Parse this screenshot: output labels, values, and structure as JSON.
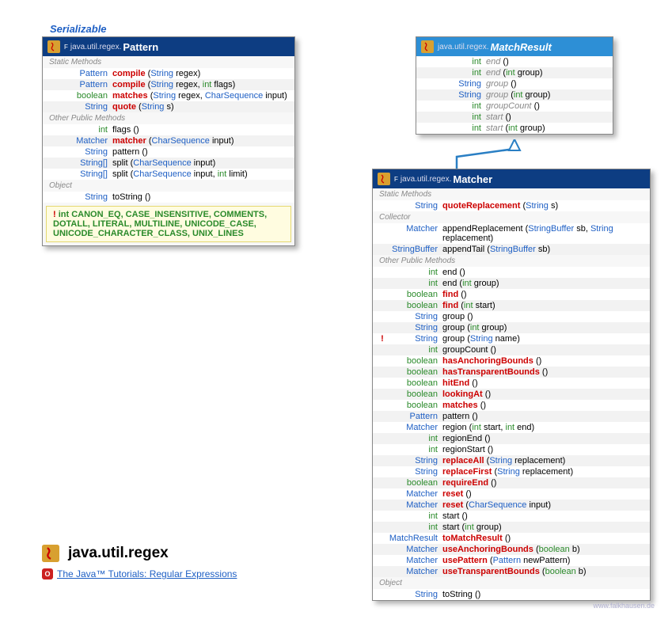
{
  "serializable": "Serializable",
  "pattern": {
    "pkg": "java.util.regex.",
    "name": "Pattern",
    "sections": {
      "static": "Static Methods",
      "other": "Other Public Methods",
      "obj": "Object"
    },
    "staticMethods": [
      {
        "ret": "Pattern",
        "retClass": "t-blue",
        "name": "compile",
        "nameClass": "t-red",
        "sig": "(String regex)"
      },
      {
        "ret": "Pattern",
        "retClass": "t-blue",
        "name": "compile",
        "nameClass": "t-red",
        "sig": "(String regex, int flags)"
      },
      {
        "ret": "boolean",
        "retClass": "t-green",
        "name": "matches",
        "nameClass": "t-red",
        "sig": "(String regex, CharSequence input)"
      },
      {
        "ret": "String",
        "retClass": "t-blue",
        "name": "quote",
        "nameClass": "t-red",
        "sig": "(String s)"
      }
    ],
    "otherMethods": [
      {
        "ret": "int",
        "retClass": "t-green",
        "name": "flags",
        "nameClass": "t-black",
        "sig": "()"
      },
      {
        "ret": "Matcher",
        "retClass": "t-blue",
        "name": "matcher",
        "nameClass": "t-red",
        "sig": "(CharSequence input)"
      },
      {
        "ret": "String",
        "retClass": "t-blue",
        "name": "pattern",
        "nameClass": "t-black",
        "sig": "()"
      },
      {
        "ret": "String[]",
        "retClass": "t-blue",
        "name": "split",
        "nameClass": "t-black",
        "sig": "(CharSequence input)"
      },
      {
        "ret": "String[]",
        "retClass": "t-blue",
        "name": "split",
        "nameClass": "t-black",
        "sig": "(CharSequence input, int limit)"
      }
    ],
    "objMethods": [
      {
        "ret": "String",
        "retClass": "t-blue",
        "name": "toString",
        "nameClass": "t-black",
        "sig": "()"
      }
    ],
    "constants": "int CANON_EQ, CASE_INSENSITIVE, COMMENTS, DOTALL, LITERAL, MULTILINE, UNICODE_CASE, UNICODE_CHARACTER_CLASS, UNIX_LINES"
  },
  "matchresult": {
    "pkg": "java.util.regex.",
    "name": "MatchResult",
    "methods": [
      {
        "ret": "int",
        "retClass": "t-green",
        "name": "end",
        "nameClass": "t-gray-it",
        "sig": "()"
      },
      {
        "ret": "int",
        "retClass": "t-green",
        "name": "end",
        "nameClass": "t-gray-it",
        "sig": "(int group)"
      },
      {
        "ret": "String",
        "retClass": "t-blue",
        "name": "group",
        "nameClass": "t-gray-it",
        "sig": "()"
      },
      {
        "ret": "String",
        "retClass": "t-blue",
        "name": "group",
        "nameClass": "t-gray-it",
        "sig": "(int group)"
      },
      {
        "ret": "int",
        "retClass": "t-green",
        "name": "groupCount",
        "nameClass": "t-gray-it",
        "sig": "()"
      },
      {
        "ret": "int",
        "retClass": "t-green",
        "name": "start",
        "nameClass": "t-gray-it",
        "sig": "()"
      },
      {
        "ret": "int",
        "retClass": "t-green",
        "name": "start",
        "nameClass": "t-gray-it",
        "sig": "(int group)"
      }
    ]
  },
  "matcher": {
    "pkg": "java.util.regex.",
    "name": "Matcher",
    "sections": {
      "static": "Static Methods",
      "collector": "Collector",
      "other": "Other Public Methods",
      "obj": "Object"
    },
    "staticMethods": [
      {
        "ret": "String",
        "retClass": "t-blue",
        "name": "quoteReplacement",
        "nameClass": "t-red",
        "sig": "(String s)"
      }
    ],
    "collectorMethods": [
      {
        "ret": "Matcher",
        "retClass": "t-blue",
        "name": "appendReplacement",
        "nameClass": "t-black",
        "sig": "(StringBuffer sb, String replacement)"
      },
      {
        "ret": "StringBuffer",
        "retClass": "t-blue",
        "name": "appendTail",
        "nameClass": "t-black",
        "sig": "(StringBuffer sb)"
      }
    ],
    "otherMethods": [
      {
        "bang": "",
        "ret": "int",
        "retClass": "t-green",
        "name": "end",
        "nameClass": "t-black",
        "sig": "()"
      },
      {
        "bang": "",
        "ret": "int",
        "retClass": "t-green",
        "name": "end",
        "nameClass": "t-black",
        "sig": "(int group)"
      },
      {
        "bang": "",
        "ret": "boolean",
        "retClass": "t-green",
        "name": "find",
        "nameClass": "t-red",
        "sig": "()"
      },
      {
        "bang": "",
        "ret": "boolean",
        "retClass": "t-green",
        "name": "find",
        "nameClass": "t-red",
        "sig": "(int start)"
      },
      {
        "bang": "",
        "ret": "String",
        "retClass": "t-blue",
        "name": "group",
        "nameClass": "t-black",
        "sig": "()"
      },
      {
        "bang": "",
        "ret": "String",
        "retClass": "t-blue",
        "name": "group",
        "nameClass": "t-black",
        "sig": "(int group)"
      },
      {
        "bang": "!",
        "ret": "String",
        "retClass": "t-blue",
        "name": "group",
        "nameClass": "t-black",
        "sig": "(String name)"
      },
      {
        "bang": "",
        "ret": "int",
        "retClass": "t-green",
        "name": "groupCount",
        "nameClass": "t-black",
        "sig": "()"
      },
      {
        "bang": "",
        "ret": "boolean",
        "retClass": "t-green",
        "name": "hasAnchoringBounds",
        "nameClass": "t-red",
        "sig": "()"
      },
      {
        "bang": "",
        "ret": "boolean",
        "retClass": "t-green",
        "name": "hasTransparentBounds",
        "nameClass": "t-red",
        "sig": "()"
      },
      {
        "bang": "",
        "ret": "boolean",
        "retClass": "t-green",
        "name": "hitEnd",
        "nameClass": "t-red",
        "sig": "()"
      },
      {
        "bang": "",
        "ret": "boolean",
        "retClass": "t-green",
        "name": "lookingAt",
        "nameClass": "t-red",
        "sig": "()"
      },
      {
        "bang": "",
        "ret": "boolean",
        "retClass": "t-green",
        "name": "matches",
        "nameClass": "t-red",
        "sig": "()"
      },
      {
        "bang": "",
        "ret": "Pattern",
        "retClass": "t-blue",
        "name": "pattern",
        "nameClass": "t-black",
        "sig": "()"
      },
      {
        "bang": "",
        "ret": "Matcher",
        "retClass": "t-blue",
        "name": "region",
        "nameClass": "t-black",
        "sig": "(int start, int end)"
      },
      {
        "bang": "",
        "ret": "int",
        "retClass": "t-green",
        "name": "regionEnd",
        "nameClass": "t-black",
        "sig": "()"
      },
      {
        "bang": "",
        "ret": "int",
        "retClass": "t-green",
        "name": "regionStart",
        "nameClass": "t-black",
        "sig": "()"
      },
      {
        "bang": "",
        "ret": "String",
        "retClass": "t-blue",
        "name": "replaceAll",
        "nameClass": "t-red",
        "sig": "(String replacement)"
      },
      {
        "bang": "",
        "ret": "String",
        "retClass": "t-blue",
        "name": "replaceFirst",
        "nameClass": "t-red",
        "sig": "(String replacement)"
      },
      {
        "bang": "",
        "ret": "boolean",
        "retClass": "t-green",
        "name": "requireEnd",
        "nameClass": "t-red",
        "sig": "()"
      },
      {
        "bang": "",
        "ret": "Matcher",
        "retClass": "t-blue",
        "name": "reset",
        "nameClass": "t-red",
        "sig": "()"
      },
      {
        "bang": "",
        "ret": "Matcher",
        "retClass": "t-blue",
        "name": "reset",
        "nameClass": "t-red",
        "sig": "(CharSequence input)"
      },
      {
        "bang": "",
        "ret": "int",
        "retClass": "t-green",
        "name": "start",
        "nameClass": "t-black",
        "sig": "()"
      },
      {
        "bang": "",
        "ret": "int",
        "retClass": "t-green",
        "name": "start",
        "nameClass": "t-black",
        "sig": "(int group)"
      },
      {
        "bang": "",
        "ret": "MatchResult",
        "retClass": "t-blue",
        "name": "toMatchResult",
        "nameClass": "t-red",
        "sig": "()"
      },
      {
        "bang": "",
        "ret": "Matcher",
        "retClass": "t-blue",
        "name": "useAnchoringBounds",
        "nameClass": "t-red",
        "sig": "(boolean b)"
      },
      {
        "bang": "",
        "ret": "Matcher",
        "retClass": "t-blue",
        "name": "usePattern",
        "nameClass": "t-red",
        "sig": "(Pattern newPattern)"
      },
      {
        "bang": "",
        "ret": "Matcher",
        "retClass": "t-blue",
        "name": "useTransparentBounds",
        "nameClass": "t-red",
        "sig": "(boolean b)"
      }
    ],
    "objMethods": [
      {
        "ret": "String",
        "retClass": "t-blue",
        "name": "toString",
        "nameClass": "t-black",
        "sig": "()"
      }
    ]
  },
  "footer": {
    "title": "java.util.regex",
    "tutorial": "The Java™ Tutorials: Regular Expressions",
    "watermark": "www.falkhausen.de"
  }
}
